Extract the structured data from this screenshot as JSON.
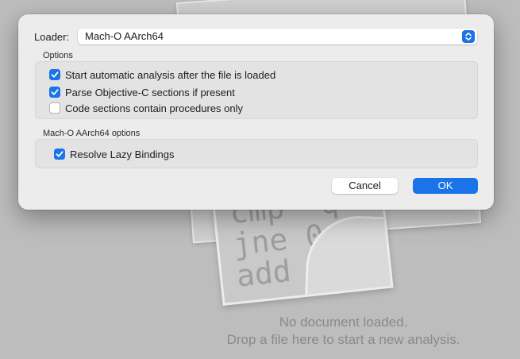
{
  "background": {
    "code_lines": [
      "cmp  q",
      "jne 0x1",
      "add rcx,"
    ],
    "empty_title": "No document loaded.",
    "empty_hint": "Drop a file here to start a new analysis."
  },
  "dialog": {
    "loader_label": "Loader:",
    "loader_value": "Mach-O AArch64",
    "options_section": "Options",
    "options": [
      {
        "label": "Start automatic analysis after the file is loaded",
        "checked": true
      },
      {
        "label": "Parse Objective-C sections if present",
        "checked": true
      },
      {
        "label": "Code sections contain procedures only",
        "checked": false
      }
    ],
    "macho_section": "Mach-O AArch64 options",
    "macho_options": [
      {
        "label": "Resolve Lazy Bindings",
        "checked": true
      }
    ],
    "cancel_label": "Cancel",
    "ok_label": "OK"
  },
  "colors": {
    "accent": "#1a73e8"
  }
}
